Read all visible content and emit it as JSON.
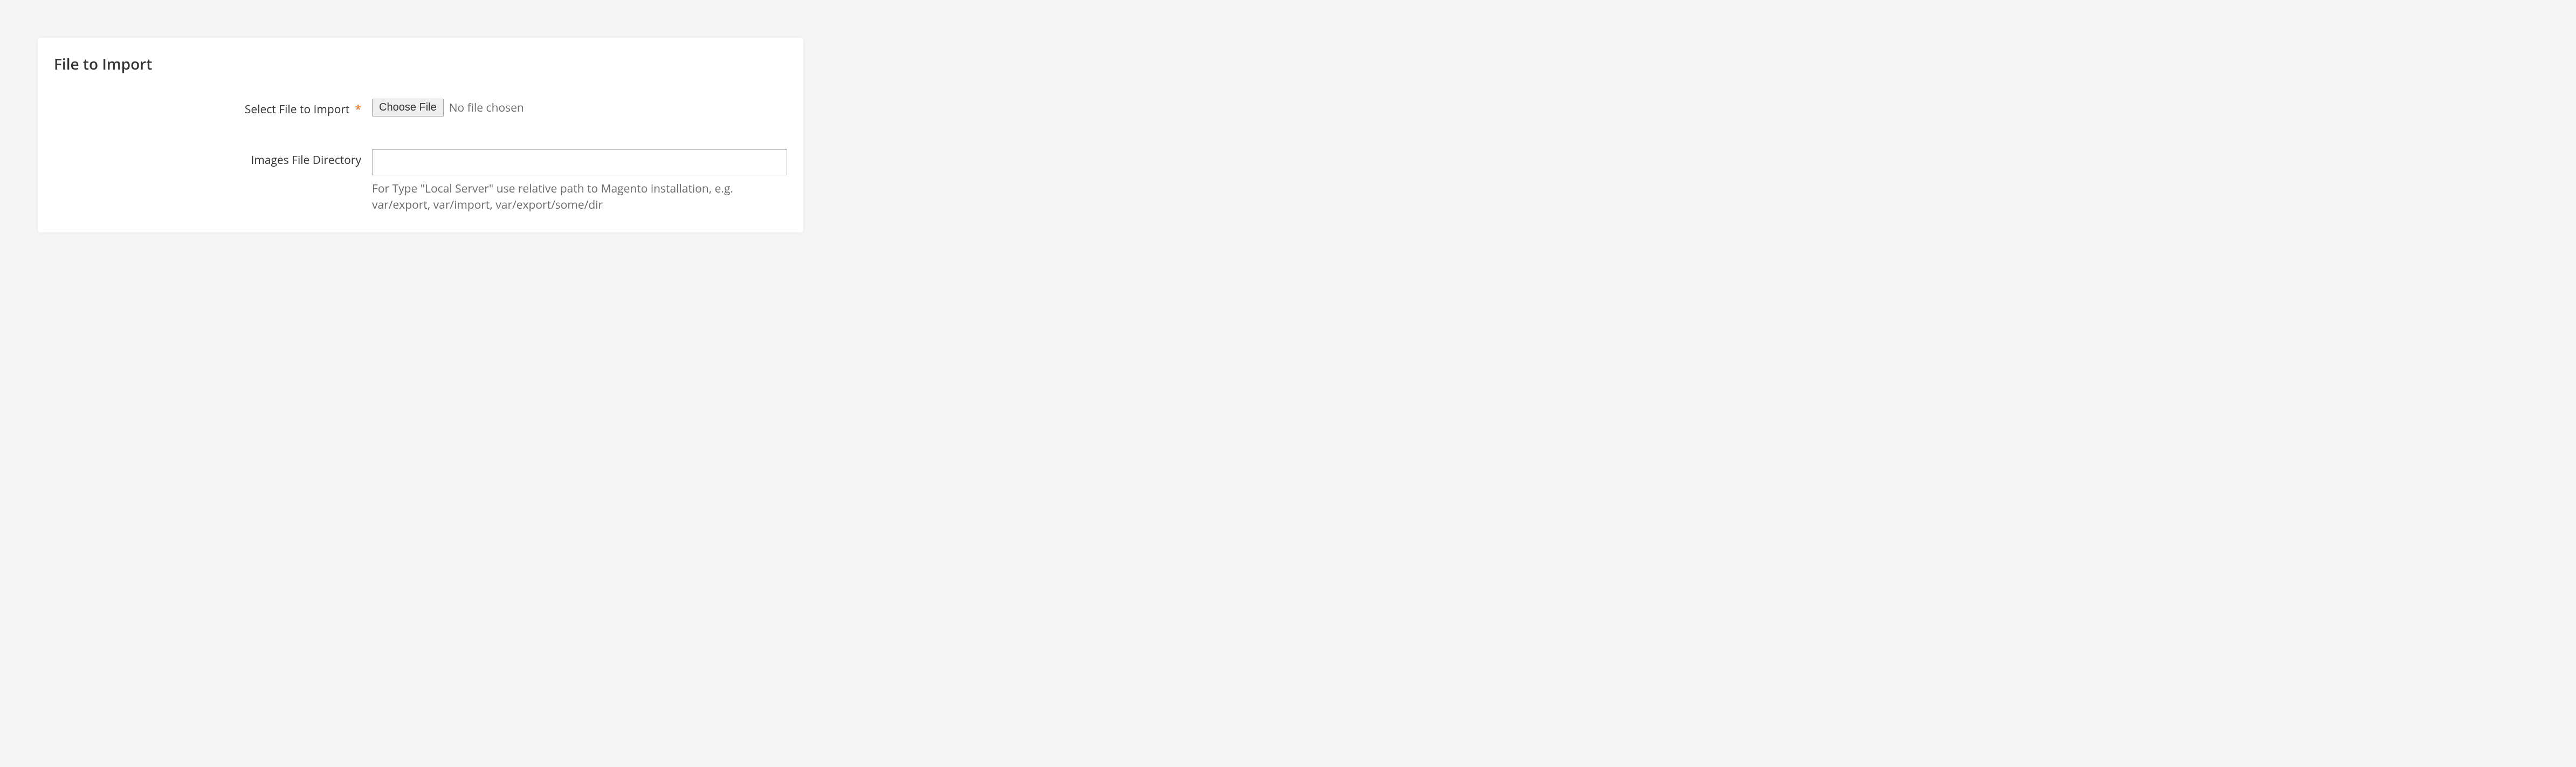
{
  "panel": {
    "title": "File to Import"
  },
  "fields": {
    "selectFile": {
      "label": "Select File to Import",
      "requiredMark": "*",
      "buttonLabel": "Choose File",
      "statusText": "No file chosen"
    },
    "imagesDir": {
      "label": "Images File Directory",
      "value": "",
      "hint": "For Type \"Local Server\" use relative path to Magento installation, e.g. var/export, var/import, var/export/some/dir"
    }
  }
}
